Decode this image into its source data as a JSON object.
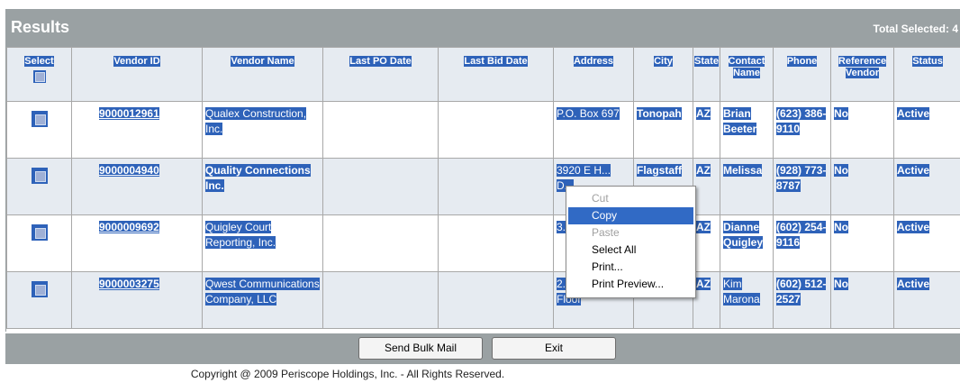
{
  "header": {
    "title": "Results",
    "total_selected": "Total Selected: 4"
  },
  "columns": [
    "Select",
    "Vendor ID",
    "Vendor Name",
    "Last PO Date",
    "Last Bid Date",
    "Address",
    "City",
    "State",
    "Contact Name",
    "Phone",
    "Reference Vendor",
    "Status"
  ],
  "rows": [
    {
      "vendor_id": "9000012961",
      "vendor_name": "Qualex Construction, Inc.",
      "last_po_date": "",
      "last_bid_date": "",
      "address": "P.O. Box 697",
      "city": "Tonopah",
      "state": "AZ",
      "contact": "Brian Beeter",
      "phone": "(623) 386-9110",
      "reference": "No",
      "status": "Active"
    },
    {
      "vendor_id": "9000004940",
      "vendor_name": "Quality Connections Inc.",
      "last_po_date": "",
      "last_bid_date": "",
      "address": "3920 E H... D...",
      "city": "Flagstaff",
      "state": "AZ",
      "contact": "Melissa",
      "phone": "(928) 773-8787",
      "reference": "No",
      "status": "Active"
    },
    {
      "vendor_id": "9000009692",
      "vendor_name": "Quigley Court Reporting, Inc.",
      "last_po_date": "",
      "last_bid_date": "",
      "address": "3... A...",
      "city": "",
      "state": "AZ",
      "contact": "Dianne Quigley",
      "phone": "(602) 254-9116",
      "reference": "No",
      "status": "Active"
    },
    {
      "vendor_id": "9000003275",
      "vendor_name": "Qwest Communications Company, LLC",
      "last_po_date": "",
      "last_bid_date": "",
      "address": "2... Rd 17th Floor",
      "city": "",
      "state": "AZ",
      "contact": "Kim Marona",
      "phone": "(602) 512-2527",
      "reference": "No",
      "status": "Active"
    }
  ],
  "buttons": {
    "send_bulk_mail": "Send Bulk Mail",
    "exit": "Exit"
  },
  "context_menu": {
    "items": [
      "Cut",
      "Copy",
      "Paste",
      "Select All",
      "Print...",
      "Print Preview..."
    ],
    "disabled": [
      "Cut",
      "Paste"
    ],
    "highlighted": "Copy"
  },
  "footer": {
    "copyright": "Copyright @ 2009 Periscope Holdings, Inc. - All Rights Reserved."
  },
  "colors": {
    "header_bar": "#9aa1a3",
    "selection": "#2e62b9",
    "row_alt": "#e6ebf1"
  }
}
